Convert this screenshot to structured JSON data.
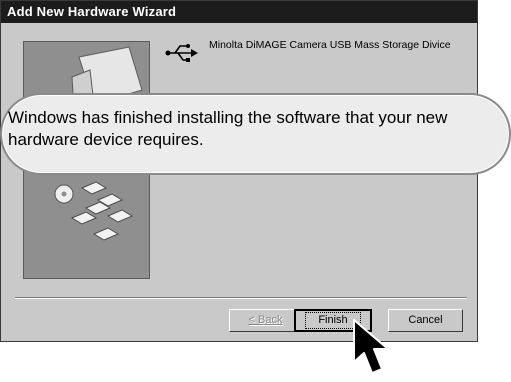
{
  "window": {
    "title": "Add New Hardware Wizard"
  },
  "device": {
    "icon": "usb-icon",
    "name": "Minolta DiMAGE Camera USB Mass Storage Divice"
  },
  "callout": {
    "message": "Windows has finished installing the software that your new hardware device requires."
  },
  "buttons": {
    "back": "< Back",
    "finish": "Finish",
    "cancel": "Cancel"
  },
  "colors": {
    "titlebar": "#1c1c1c",
    "dialog": "#c9c9c9",
    "side_panel": "#8f8f8f",
    "callout": "#ececec"
  }
}
